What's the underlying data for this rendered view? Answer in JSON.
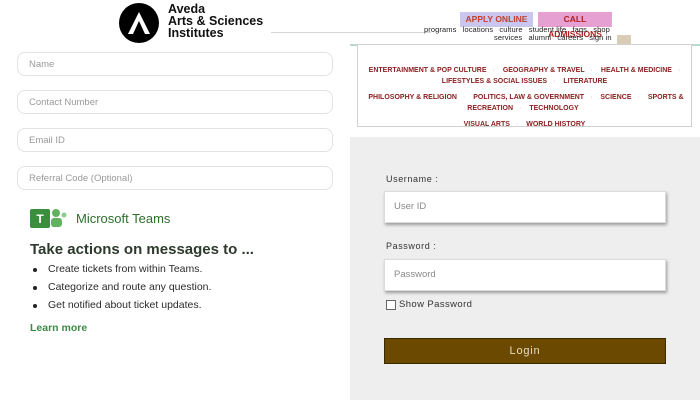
{
  "header": {
    "brand_line1": "Aveda",
    "brand_line2": "Arts & Sciences",
    "brand_line3": "Institutes",
    "apply_label": "APPLY ONLINE",
    "admissions_label": "CALL ADMISSIONS",
    "nav_row1": [
      "programs",
      "locations",
      "culture",
      "student life",
      "faqs",
      "shop"
    ],
    "nav_row2": [
      "services",
      "alumni",
      "careers",
      "sign in"
    ]
  },
  "form": {
    "name_placeholder": "Name",
    "contact_placeholder": "Contact Number",
    "email_placeholder": "Email ID",
    "referral_placeholder": "Referral Code (Optional)"
  },
  "teams": {
    "name": "Microsoft Teams",
    "title": "Take actions on messages to ...",
    "bullets": [
      "Create tickets from within Teams.",
      "Categorize and route any question.",
      "Get notified about ticket updates."
    ],
    "learn_more": "Learn more"
  },
  "topics": {
    "line1": [
      "ENTERTAINMENT & POP CULTURE",
      "GEOGRAPHY & TRAVEL",
      "HEALTH & MEDICINE",
      "LIFESTYLES & SOCIAL ISSUES",
      "LITERATURE"
    ],
    "line2": [
      "PHILOSOPHY & RELIGION",
      "POLITICS, LAW & GOVERNMENT",
      "SCIENCE",
      "SPORTS & RECREATION",
      "TECHNOLOGY"
    ],
    "line3": [
      "VISUAL ARTS",
      "WORLD HISTORY"
    ]
  },
  "login": {
    "username_label": "Username :",
    "username_placeholder": "User ID",
    "password_label": "Password :",
    "password_placeholder": "Password",
    "show_password": "Show Password",
    "login_button": "Login"
  }
}
